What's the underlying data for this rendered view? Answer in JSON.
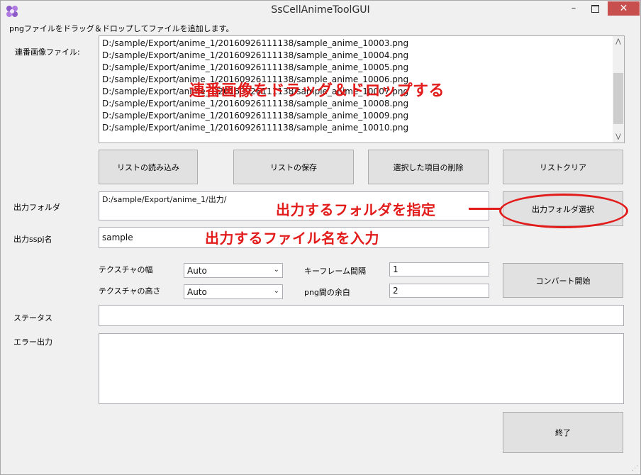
{
  "window": {
    "title": "SsCellAnimeToolGUI",
    "controls": {
      "minimize": "–",
      "close": "✕"
    }
  },
  "hint": "pngファイルをドラッグ＆ドロップしてファイルを追加します。",
  "image_list": {
    "label": "連番画像ファイル:",
    "items": [
      "D:/sample/Export/anime_1/20160926111138/sample_anime_10003.png",
      "D:/sample/Export/anime_1/20160926111138/sample_anime_10004.png",
      "D:/sample/Export/anime_1/20160926111138/sample_anime_10005.png",
      "D:/sample/Export/anime_1/20160926111138/sample_anime_10006.png",
      "D:/sample/Export/anime_1/20160926111138/sample_anime_10007.png",
      "D:/sample/Export/anime_1/20160926111138/sample_anime_10008.png",
      "D:/sample/Export/anime_1/20160926111138/sample_anime_10009.png",
      "D:/sample/Export/anime_1/20160926111138/sample_anime_10010.png"
    ]
  },
  "list_buttons": {
    "load": "リストの読み込み",
    "save": "リストの保存",
    "delete_selected": "選択した項目の削除",
    "clear": "リストクリア"
  },
  "output_folder": {
    "label": "出力フォルダ",
    "value": "D:/sample/Export/anime_1/出力/",
    "button": "出力フォルダ選択"
  },
  "output_name": {
    "label": "出力sspj名",
    "value": "sample"
  },
  "options": {
    "texture_width_label": "テクスチャの幅",
    "texture_width_value": "Auto",
    "texture_height_label": "テクスチャの高さ",
    "texture_height_value": "Auto",
    "keyframe_interval_label": "キーフレーム間隔",
    "keyframe_interval_value": "1",
    "png_margin_label": "png間の余白",
    "png_margin_value": "2"
  },
  "convert_button": "コンバート開始",
  "status": {
    "label": "ステータス",
    "value": ""
  },
  "error_output": {
    "label": "エラー出力",
    "value": ""
  },
  "exit_button": "終了",
  "annotations": {
    "drag_drop": "連番画像をドラッグ＆ドロップする",
    "specify_folder": "出力するフォルダを指定",
    "enter_filename": "出力するファイル名を入力"
  },
  "colors": {
    "annotation": "#e21b1b",
    "close_button": "#c7504f"
  },
  "icons": {
    "app": "flower-icon",
    "dropdown": "chevron-down-icon"
  }
}
